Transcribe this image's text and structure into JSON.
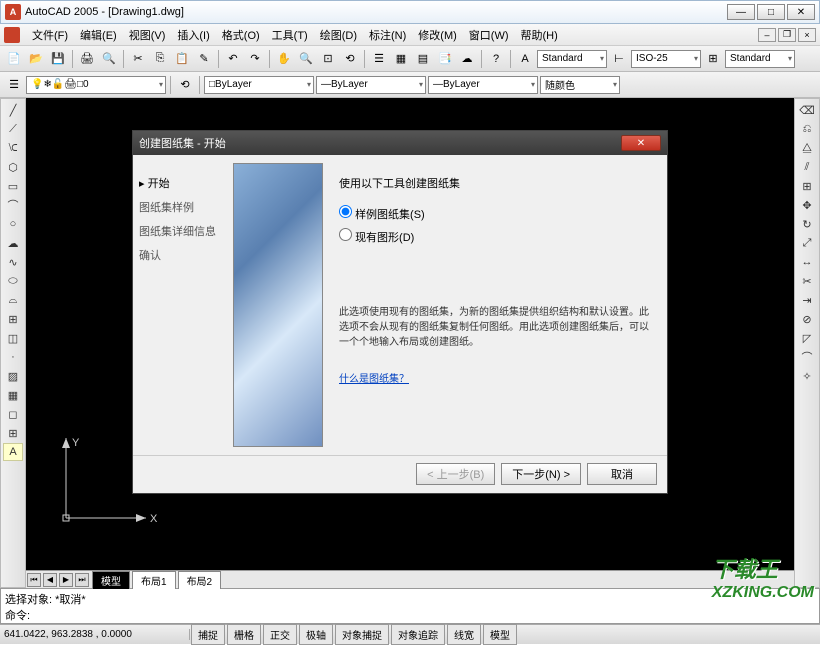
{
  "title": "AutoCAD 2005 - [Drawing1.dwg]",
  "menu": [
    "文件(F)",
    "编辑(E)",
    "视图(V)",
    "插入(I)",
    "格式(O)",
    "工具(T)",
    "绘图(D)",
    "标注(N)",
    "修改(M)",
    "窗口(W)",
    "帮助(H)"
  ],
  "styles": {
    "text": "Standard",
    "dim": "ISO-25",
    "table": "Standard"
  },
  "layer": {
    "current": "0",
    "color": "ByLayer",
    "ltype": "ByLayer",
    "lweight": "ByLayer",
    "plot": "随颜色"
  },
  "tabs": {
    "model": "模型",
    "layouts": [
      "布局1",
      "布局2"
    ]
  },
  "cmd": {
    "line1": "选择对象: *取消*",
    "line2": "命令:"
  },
  "status": {
    "coords": "641.0422, 963.2838 , 0.0000",
    "buttons": [
      "捕捉",
      "栅格",
      "正交",
      "极轴",
      "对象捕捉",
      "对象追踪",
      "线宽",
      "模型"
    ]
  },
  "dialog": {
    "title": "创建图纸集 - 开始",
    "nav": [
      "开始",
      "图纸集样例",
      "图纸集详细信息",
      "确认"
    ],
    "heading": "使用以下工具创建图纸集",
    "opt1": "样例图纸集(S)",
    "opt2": "现有图形(D)",
    "desc": "此选项使用现有的图纸集，为新的图纸集提供组织结构和默认设置。此选项不会从现有的图纸集复制任何图纸。用此选项创建图纸集后，可以一个个地输入布局或创建图纸。",
    "link": "什么是图纸集？",
    "back": "< 上一步(B)",
    "next": "下一步(N) >",
    "cancel": "取消"
  },
  "watermark": {
    "cn": "下载王",
    "en": "XZKING.COM"
  }
}
